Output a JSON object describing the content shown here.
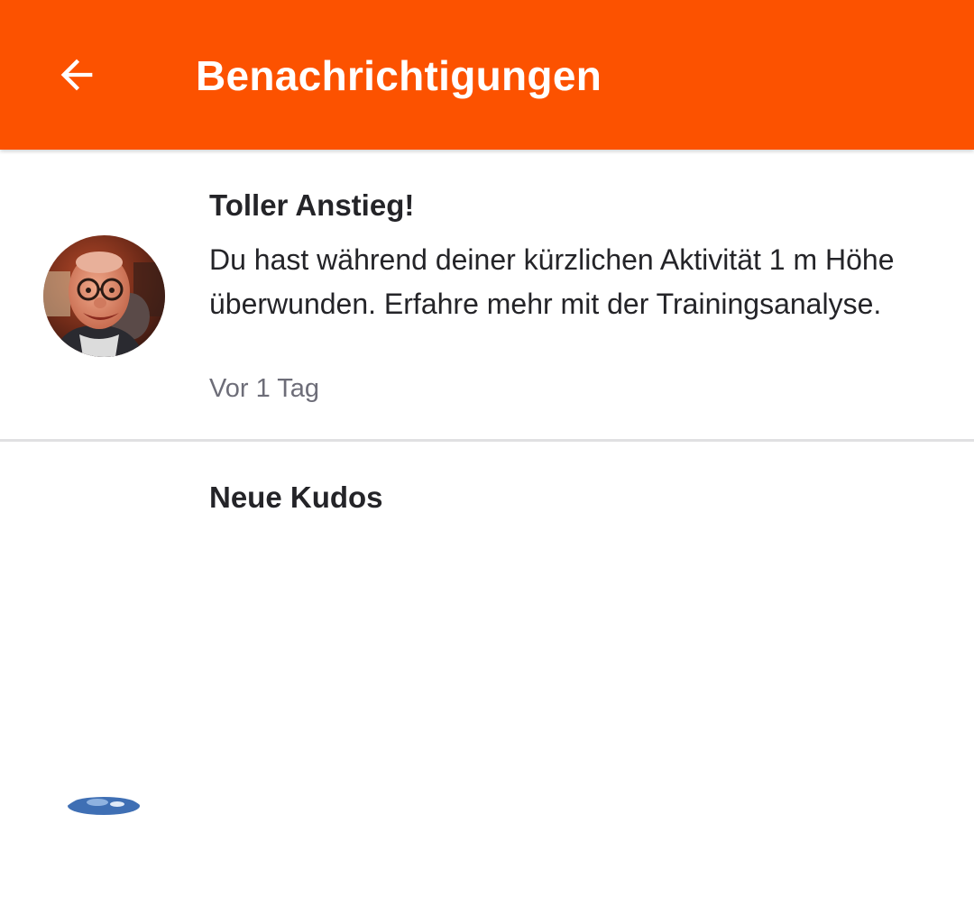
{
  "appbar": {
    "title": "Benachrichtigungen",
    "back_icon": "arrow-back-icon",
    "color": "#fc5200"
  },
  "notifications": [
    {
      "title": "Toller Anstieg!",
      "body": "Du hast während deiner kürzlichen Aktivität 1 m Höhe überwunden. Erfahre mehr mit der Trainingsanalyse.",
      "time": "Vor 1 Tag",
      "avatar": "user-avatar"
    },
    {
      "title": "Neue Kudos",
      "avatar": "user-avatar"
    }
  ]
}
